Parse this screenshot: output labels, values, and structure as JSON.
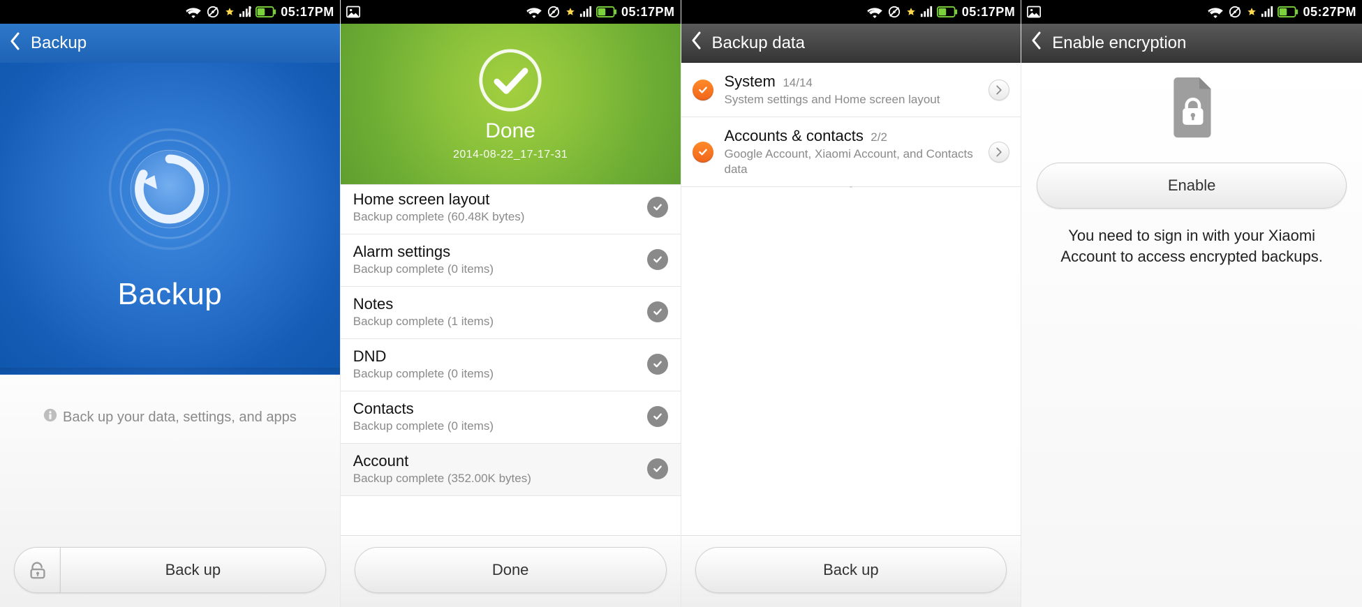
{
  "statusbar": {
    "time_a": "05:17PM",
    "time_b": "05:27PM"
  },
  "s1": {
    "header": "Backup",
    "hero": "Backup",
    "info": "Back up your data, settings, and apps",
    "button": "Back up"
  },
  "s2": {
    "done": "Done",
    "date": "2014-08-22_17-17-31",
    "items": [
      {
        "title": "Home screen layout",
        "sub": "Backup complete (60.48K  bytes)"
      },
      {
        "title": "Alarm settings",
        "sub": "Backup complete (0  items)"
      },
      {
        "title": "Notes",
        "sub": "Backup complete (1  items)"
      },
      {
        "title": "DND",
        "sub": "Backup complete (0  items)"
      },
      {
        "title": "Contacts",
        "sub": "Backup complete (0  items)"
      },
      {
        "title": "Account",
        "sub": "Backup complete (352.00K  bytes)"
      }
    ],
    "button": "Done"
  },
  "s3": {
    "header": "Backup data",
    "cats": [
      {
        "title": "System",
        "count": "14/14",
        "sub": "System settings and Home screen layout"
      },
      {
        "title": "Accounts & contacts",
        "count": "2/2",
        "sub": "Google Account, Xiaomi Account, and Contacts data"
      }
    ],
    "button": "Back up"
  },
  "s4": {
    "header": "Enable encryption",
    "button": "Enable",
    "msg": "You need to sign in with your Xiaomi Account to access encrypted backups."
  }
}
